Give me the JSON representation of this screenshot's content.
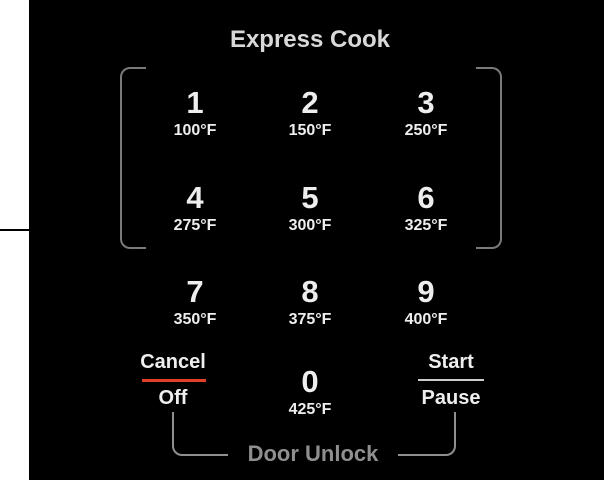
{
  "title": "Express Cook",
  "keys": [
    {
      "digit": "1",
      "temp": "100°F"
    },
    {
      "digit": "2",
      "temp": "150°F"
    },
    {
      "digit": "3",
      "temp": "250°F"
    },
    {
      "digit": "4",
      "temp": "275°F"
    },
    {
      "digit": "5",
      "temp": "300°F"
    },
    {
      "digit": "6",
      "temp": "325°F"
    },
    {
      "digit": "7",
      "temp": "350°F"
    },
    {
      "digit": "8",
      "temp": "375°F"
    },
    {
      "digit": "9",
      "temp": "400°F"
    },
    {
      "digit": "0",
      "temp": "425°F"
    }
  ],
  "cancel": {
    "top": "Cancel",
    "bottom": "Off"
  },
  "start": {
    "top": "Start",
    "bottom": "Pause"
  },
  "door_unlock": "Door Unlock",
  "colors": {
    "background": "#000000",
    "text": "#eeeeee",
    "bracket": "#7a7a7a",
    "cancel_accent": "#e0402a",
    "start_divider": "#cccccc",
    "door_unlock": "#8f8f8f"
  }
}
